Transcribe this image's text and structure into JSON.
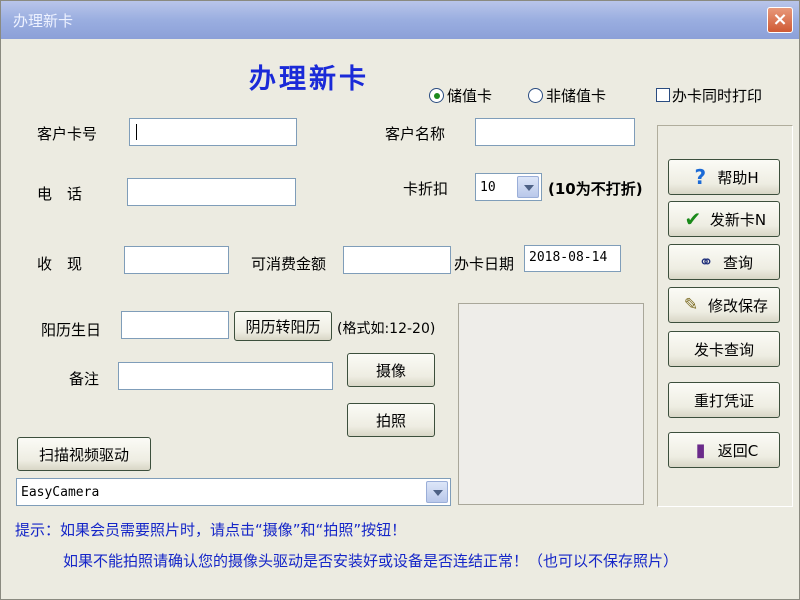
{
  "window": {
    "title": "办理新卡",
    "close_glyph": "×"
  },
  "heading": "办理新卡",
  "card_type": {
    "stored_value": {
      "label": "储值卡",
      "selected": true
    },
    "non_stored_value": {
      "label": "非储值卡",
      "selected": false
    },
    "print_on_issue": {
      "label": "办卡同时打印",
      "checked": false
    }
  },
  "fields": {
    "card_no_label": "客户卡号",
    "card_no_value": "",
    "name_label": "客户名称",
    "name_value": "",
    "phone_label": "电　话",
    "phone_value": "",
    "discount_label": "卡折扣",
    "discount_value": "10",
    "discount_note": "(10为不打折)",
    "cash_label": "收　现",
    "cash_value": "",
    "spendable_label": "可消费金额",
    "spendable_value": "",
    "issue_date_label": "办卡日期",
    "issue_date_value": "2018-08-14",
    "birthday_label": "阳历生日",
    "birthday_value": "",
    "lunar_convert_button": "阴历转阳历",
    "birthday_format_hint": "(格式如:12-20)",
    "remark_label": "备注",
    "remark_value": ""
  },
  "camera": {
    "capture_button": "摄像",
    "photo_button": "拍照",
    "scan_driver_button": "扫描视频驱动",
    "driver_selected": "EasyCamera"
  },
  "actions": {
    "help": {
      "label": "帮助H",
      "icon": "question-icon"
    },
    "issue": {
      "label": "发新卡N",
      "icon": "checkmark-icon"
    },
    "query": {
      "label": "查询",
      "icon": "binoculars-icon"
    },
    "save_edit": {
      "label": "修改保存",
      "icon": "edit-document-icon"
    },
    "issue_query": {
      "label": "发卡查询"
    },
    "reprint": {
      "label": "重打凭证"
    },
    "back": {
      "label": "返回C",
      "icon": "exit-door-icon"
    }
  },
  "hints": {
    "line1": "提示：如果会员需要照片时，请点击“摄像”和“拍照”按钮！",
    "line2": "如果不能拍照请确认您的摄像头驱动是否安装好或设备是否连结正常！（也可以不保存照片）"
  },
  "colors": {
    "heading": "#1a2ad8",
    "hint": "#1526c8",
    "window_bg": "#ecebe1",
    "titlebar": "#9aaee0"
  }
}
